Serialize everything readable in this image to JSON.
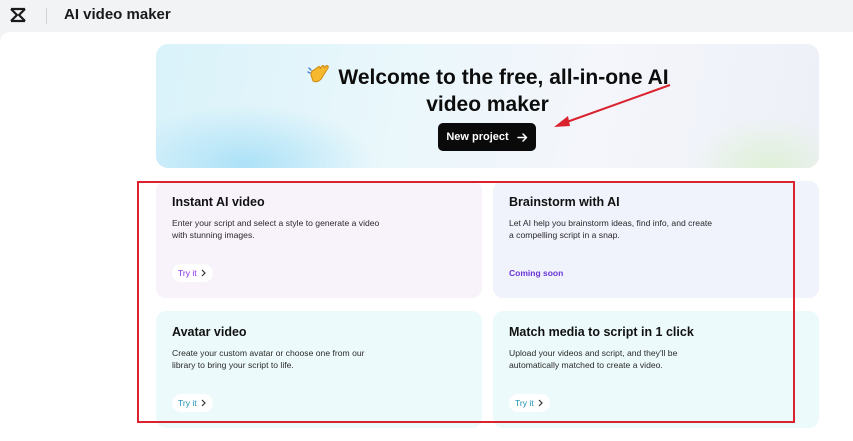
{
  "header": {
    "app_title": "AI video maker",
    "logo_icon": "capcut-logo-icon"
  },
  "hero": {
    "emoji_icon": "waving-hand-icon",
    "title": "Welcome to the free, all-in-one AI video maker",
    "title_line1": "Welcome to the free, all-in-one AI",
    "title_line2": "video maker",
    "new_project_label": "New project",
    "new_project_icon": "arrow-right-icon"
  },
  "cards": [
    {
      "title": "Instant AI video",
      "description": "Enter your script and select a style to generate a video with stunning images.",
      "action": "Try it",
      "action_color": "#8a2be2"
    },
    {
      "title": "Brainstorm with AI",
      "description": "Let AI help you brainstorm ideas, find info, and create a compelling script in a snap.",
      "status": "Coming soon",
      "status_color": "#6a35d8"
    },
    {
      "title": "Avatar video",
      "description": "Create your custom avatar or choose one from our library to bring your script to life.",
      "action": "Try it",
      "action_color": "#1b8fb0"
    },
    {
      "title": "Match media to script in 1 click",
      "description": "Upload your videos and script, and they'll be automatically matched to create a video.",
      "action": "Try it",
      "action_color": "#1b8fb0"
    }
  ],
  "annotations": {
    "highlight_color": "#d9232e",
    "arrow_color": "#d9232e"
  }
}
